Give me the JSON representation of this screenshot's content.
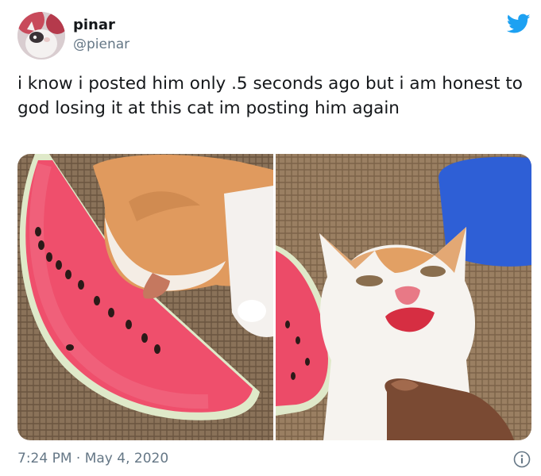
{
  "user": {
    "display_name": "pinar",
    "handle": "@pienar",
    "avatar_icon": "cat-avatar"
  },
  "brand": {
    "logo_icon": "twitter-bird-icon",
    "accent": "#1da1f2"
  },
  "tweet": {
    "text": "i know i posted him only .5 seconds ago but i am honest to god losing it at this cat im posting him again",
    "images": [
      {
        "description_icon": "cat-eating-watermelon-photo"
      },
      {
        "description_icon": "cat-with-watermelon-face-photo"
      }
    ]
  },
  "meta": {
    "time": "7:24 PM",
    "separator": " · ",
    "date": "May 4, 2020",
    "info_icon": "info-icon"
  },
  "colors": {
    "text_primary": "#14171a",
    "text_secondary": "#657786",
    "watermelon_red": "#f0506e",
    "watermelon_rind": "#6b9a4a"
  }
}
